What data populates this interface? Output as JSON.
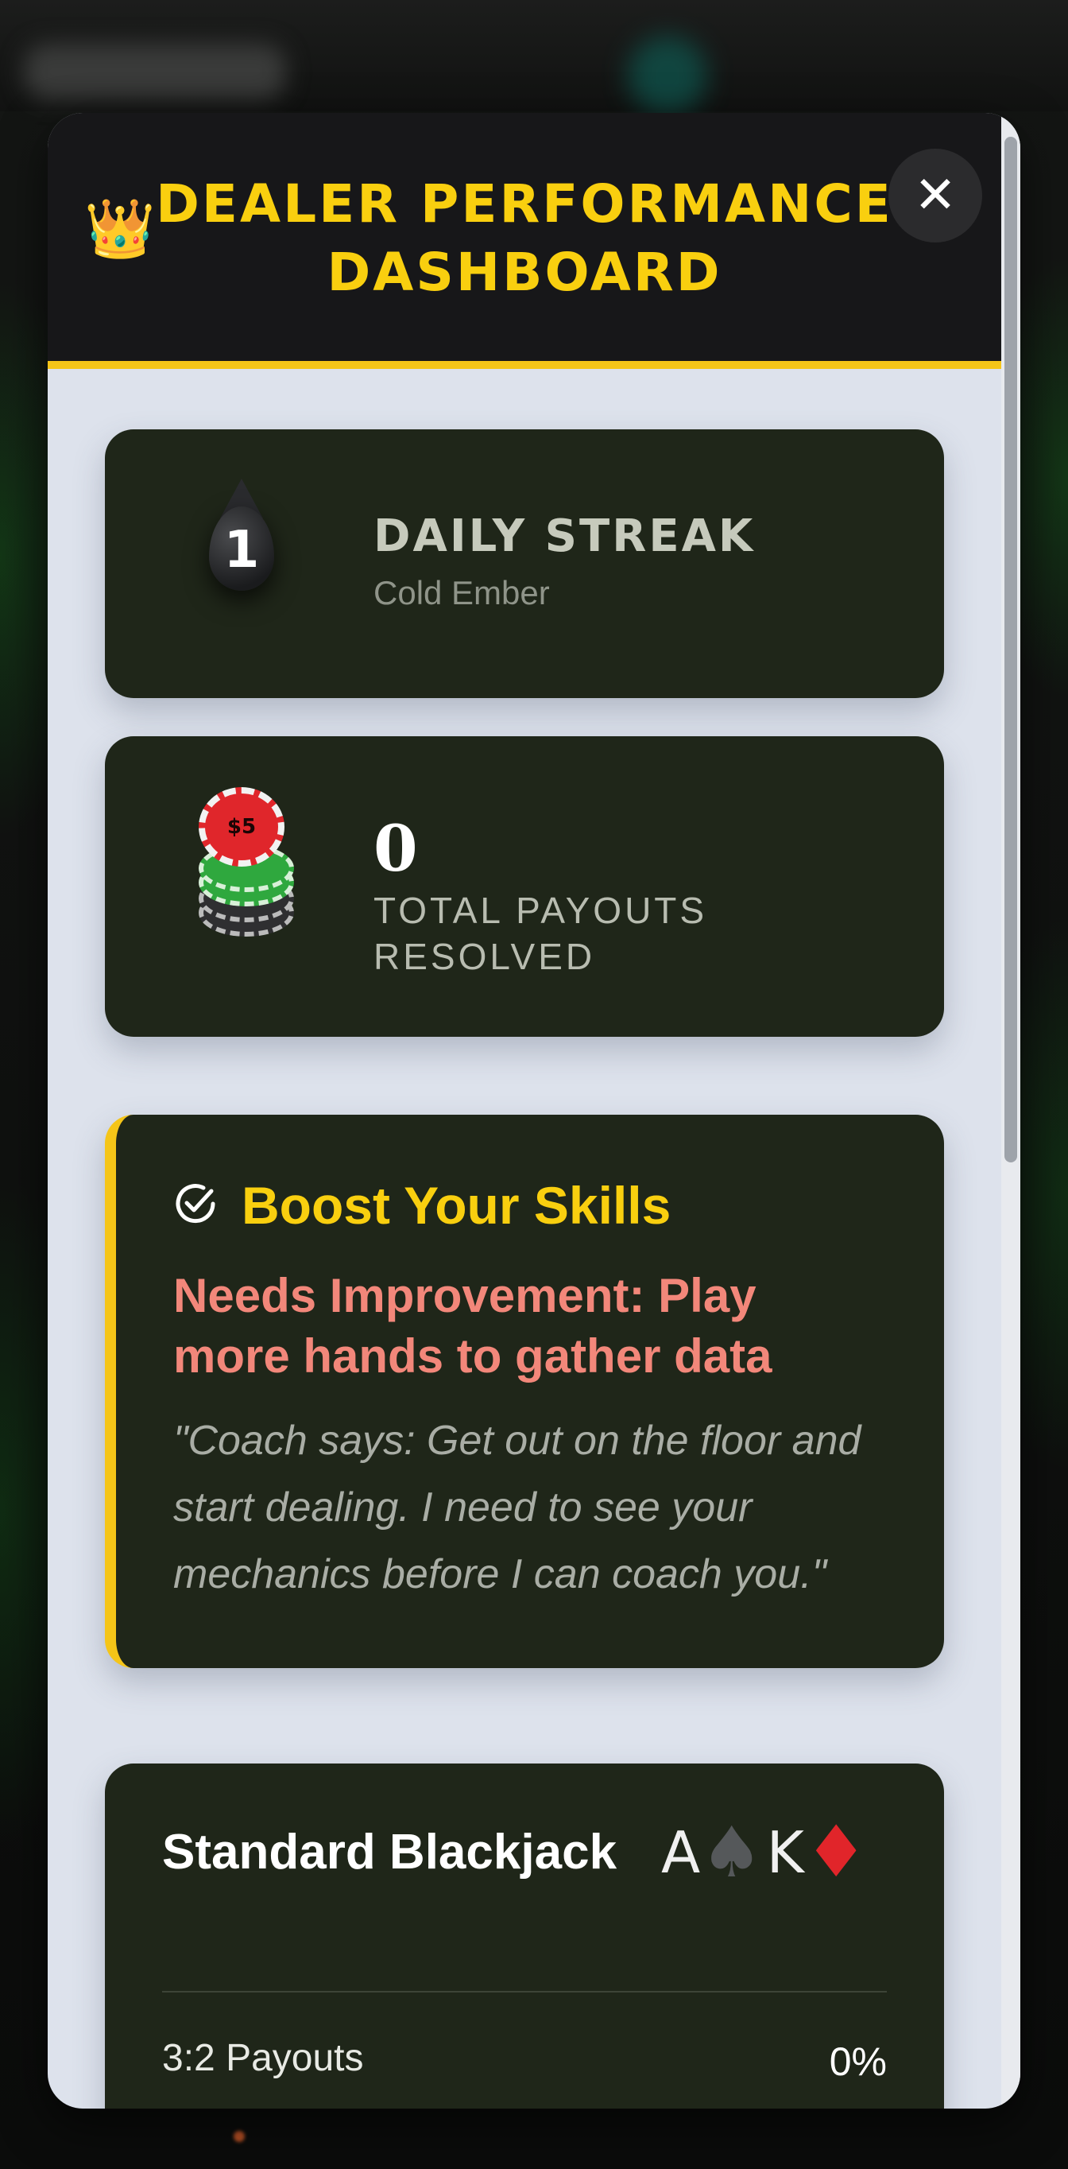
{
  "modal": {
    "title": "DEALER PERFORMANCE DASHBOARD",
    "close_symbol": "✕",
    "crown_icon": "👑"
  },
  "streak": {
    "value": "1",
    "title": "DAILY STREAK",
    "subtitle": "Cold Ember"
  },
  "payouts": {
    "chip_label": "$5",
    "value": "0",
    "label": "TOTAL PAYOUTS RESOLVED"
  },
  "coaching": {
    "title": "Boost Your Skills",
    "status": "Needs Improvement: Play more hands to gather data",
    "quote": "\"Coach says: Get out on the floor and start dealing. I need to see your mechanics before I can coach you.\""
  },
  "game": {
    "title": "Standard Blackjack",
    "card1_rank": "A",
    "card1_suit": "♠",
    "card2_rank": "K",
    "card2_suit": "♦",
    "metric_label": "3:2 Payouts",
    "metric_value": "0%",
    "progress": 0
  },
  "colors": {
    "accent": "#f5c518",
    "card_bg": "#1f2619",
    "status_warning": "#f2877a"
  }
}
